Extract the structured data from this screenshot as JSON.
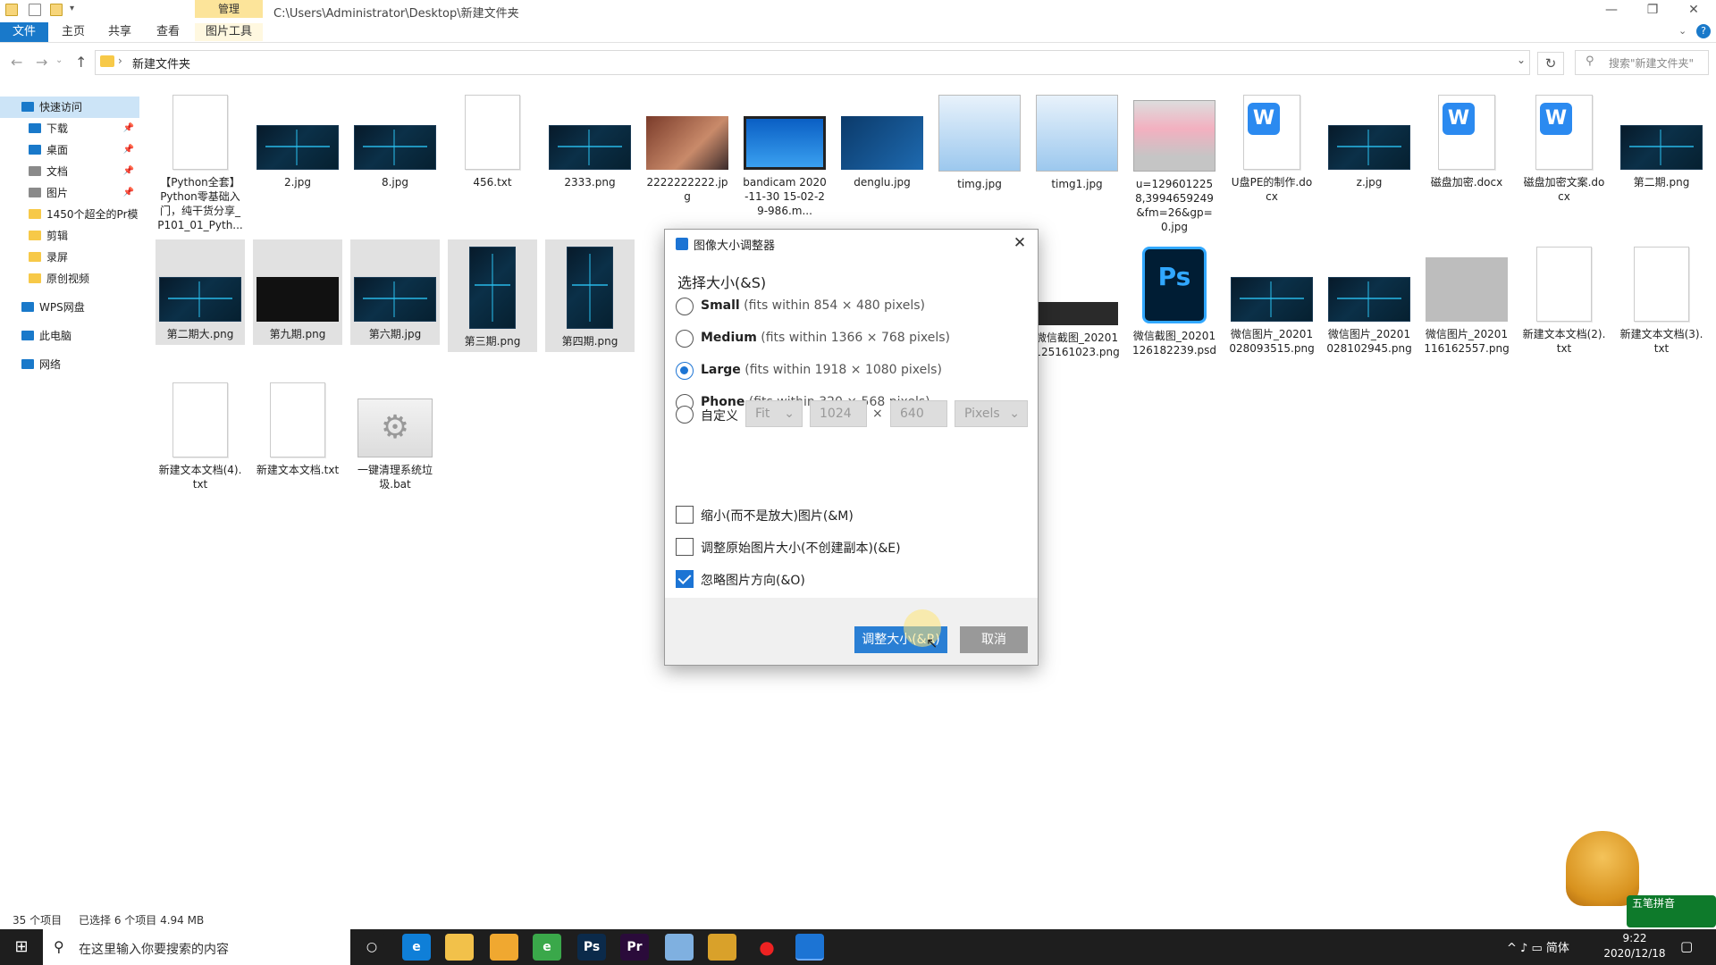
{
  "window": {
    "path": "C:\\Users\\Administrator\\Desktop\\新建文件夹",
    "context_tab": "管理",
    "context_sub_tab": "图片工具",
    "controls": {
      "minimize": "—",
      "restore": "❐",
      "close": "✕"
    }
  },
  "ribbon": {
    "tabs": [
      "文件",
      "主页",
      "共享",
      "查看"
    ]
  },
  "address": {
    "folder": "新建文件夹",
    "search_placeholder": "搜索\"新建文件夹\""
  },
  "nav": {
    "items": [
      {
        "label": "快速访问",
        "icon": "star-icon",
        "color": "#1979ca"
      },
      {
        "label": "下载",
        "icon": "download-icon",
        "color": "#1979ca",
        "pinned": true
      },
      {
        "label": "桌面",
        "icon": "desktop-icon",
        "color": "#1979ca",
        "pinned": true
      },
      {
        "label": "文档",
        "icon": "document-icon",
        "color": "#8a8a8a",
        "pinned": true
      },
      {
        "label": "图片",
        "icon": "picture-icon",
        "color": "#8a8a8a",
        "pinned": true
      },
      {
        "label": "1450个超全的Pr模",
        "icon": "folder-icon",
        "color": "#f7c948"
      },
      {
        "label": "剪辑",
        "icon": "folder-icon",
        "color": "#f7c948"
      },
      {
        "label": "录屏",
        "icon": "folder-icon",
        "color": "#f7c948"
      },
      {
        "label": "原创视频",
        "icon": "folder-icon",
        "color": "#f7c948"
      },
      {
        "label": "WPS网盘",
        "icon": "cloud-icon",
        "color": "#1979ca"
      },
      {
        "label": "此电脑",
        "icon": "computer-icon",
        "color": "#1979ca"
      },
      {
        "label": "网络",
        "icon": "network-icon",
        "color": "#1979ca"
      }
    ]
  },
  "files": [
    {
      "name": "【Python全套】Python零基础入门，纯干货分享_P101_01_Pyth...",
      "kind": "doc",
      "selected": false
    },
    {
      "name": "2.jpg",
      "kind": "dark",
      "selected": false
    },
    {
      "name": "8.jpg",
      "kind": "dark",
      "selected": false
    },
    {
      "name": "456.txt",
      "kind": "doc",
      "selected": false
    },
    {
      "name": "2333.png",
      "kind": "dark",
      "selected": false
    },
    {
      "name": "2222222222.jpg",
      "kind": "photo",
      "selected": false
    },
    {
      "name": "bandicam 2020-11-30 15-02-29-986.m...",
      "kind": "win",
      "selected": false
    },
    {
      "name": "denglu.jpg",
      "kind": "login",
      "selected": false
    },
    {
      "name": "timg.jpg",
      "kind": "screen",
      "selected": false
    },
    {
      "name": "timg1.jpg",
      "kind": "screen",
      "selected": false
    },
    {
      "name": "u=1296012258,3994659249&fm=26&gp=0.jpg",
      "kind": "imac",
      "selected": false
    },
    {
      "name": "U盘PE的制作.docx",
      "kind": "word",
      "selected": false
    },
    {
      "name": "z.jpg",
      "kind": "dark",
      "selected": false
    },
    {
      "name": "磁盘加密.docx",
      "kind": "word",
      "selected": false
    },
    {
      "name": "磁盘加密文案.docx",
      "kind": "word",
      "selected": false
    },
    {
      "name": "第二期.png",
      "kind": "dark",
      "selected": false
    },
    {
      "name": "第二期大.png",
      "kind": "dark",
      "selected": true
    },
    {
      "name": "第九期.png",
      "kind": "black",
      "selected": true
    },
    {
      "name": "第六期.jpg",
      "kind": "dark",
      "selected": true
    },
    {
      "name": "第三期.png",
      "kind": "darktall",
      "selected": true
    },
    {
      "name": "第四期.png",
      "kind": "darktall",
      "selected": true
    },
    {
      "name": "微信截图_20201125161023.png",
      "kind": "shot",
      "selected": false
    },
    {
      "name": "微信截图_20201126182239.psd",
      "kind": "psd",
      "selected": false
    },
    {
      "name": "微信图片_20201028093515.png",
      "kind": "dark",
      "selected": false
    },
    {
      "name": "微信图片_20201028102945.png",
      "kind": "dark",
      "selected": false
    },
    {
      "name": "微信图片_20201116162557.png",
      "kind": "gray",
      "selected": false
    },
    {
      "name": "新建文本文档(2).txt",
      "kind": "doc",
      "selected": false
    },
    {
      "name": "新建文本文档(3).txt",
      "kind": "doc",
      "selected": false
    },
    {
      "name": "新建文本文档(4).txt",
      "kind": "doc",
      "selected": false
    },
    {
      "name": "新建文本文档.txt",
      "kind": "doc",
      "selected": false
    },
    {
      "name": "一键清理系统垃圾.bat",
      "kind": "bat",
      "selected": false
    }
  ],
  "status": {
    "count": "35 个项目",
    "selection": "已选择 6 个项目  4.94 MB"
  },
  "dialog": {
    "title": "图像大小调整器",
    "heading": "选择大小(&S)",
    "options": [
      {
        "name": "Small",
        "detail": "(fits within 854 × 480 pixels)",
        "checked": false
      },
      {
        "name": "Medium",
        "detail": "(fits within 1366 × 768 pixels)",
        "checked": false
      },
      {
        "name": "Large",
        "detail": "(fits within 1918 × 1080 pixels)",
        "checked": true
      },
      {
        "name": "Phone",
        "detail": "(fits within 320 × 568 pixels)",
        "checked": false
      }
    ],
    "custom": {
      "label": "自定义",
      "fit": "Fit",
      "width": "1024",
      "times": "×",
      "height": "640",
      "unit": "Pixels"
    },
    "checkboxes": [
      {
        "label": "缩小(而不是放大)图片(&M)",
        "checked": false
      },
      {
        "label": "调整原始图片大小(不创建副本)(&E)",
        "checked": false
      },
      {
        "label": "忽略图片方向(&O)",
        "checked": true
      }
    ],
    "ok": "调整大小(&R)",
    "cancel": "取消"
  },
  "taskbar": {
    "search_placeholder": "在这里输入你要搜索的内容",
    "apps": [
      {
        "name": "task-view",
        "glyph": "○",
        "color": "#1e1e1e"
      },
      {
        "name": "edge",
        "glyph": "e",
        "color": "#0f7fd8"
      },
      {
        "name": "file-explorer",
        "glyph": "",
        "color": "#f2c14a"
      },
      {
        "name": "store",
        "glyph": "",
        "color": "#f0a830"
      },
      {
        "name": "app-green",
        "glyph": "e",
        "color": "#3aa84a"
      },
      {
        "name": "photoshop",
        "glyph": "Ps",
        "color": "#0b2a4a"
      },
      {
        "name": "premiere",
        "glyph": "Pr",
        "color": "#2a0b3a"
      },
      {
        "name": "app-blue",
        "glyph": "",
        "color": "#7fb0e0"
      },
      {
        "name": "app-grid",
        "glyph": "",
        "color": "#d9a12a"
      },
      {
        "name": "recorder",
        "glyph": "●",
        "color": "#1e1e1e"
      },
      {
        "name": "resizer",
        "glyph": "",
        "color": "#1c74d4"
      }
    ],
    "tray": "^  ♪  ▭  简体",
    "time": "9:22",
    "date": "2020/12/18",
    "ime_label": "五笔拼音"
  }
}
